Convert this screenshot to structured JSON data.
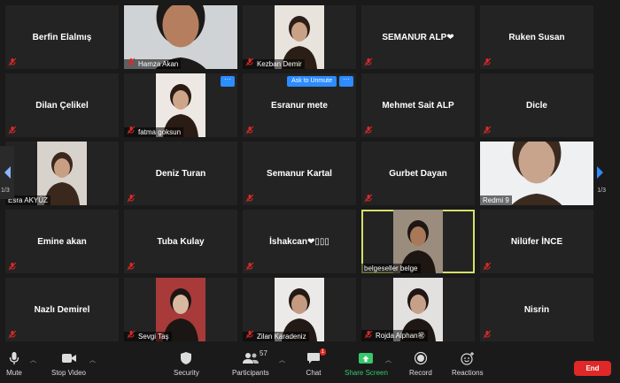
{
  "tiles": [
    {
      "type": "name",
      "name": "Berfin Elalmış"
    },
    {
      "type": "video",
      "label": "Hamza Akan",
      "bg": "#cfd3d6",
      "skin": "#b57f5f",
      "hair": "#1c1a18",
      "wide": "full"
    },
    {
      "type": "video",
      "label": "Kezban Demir",
      "bg": "#e8e3dc",
      "skin": "#c9a186",
      "hair": "#2b1e16",
      "wide": "narrow"
    },
    {
      "type": "name",
      "name": "SEMANUR ALP❤"
    },
    {
      "type": "name",
      "name": "Ruken Susan"
    },
    {
      "type": "name",
      "name": "Dilan Çelikel"
    },
    {
      "type": "video",
      "label": "fatma goksun",
      "bg": "#ede8e3",
      "skin": "#cfa58a",
      "hair": "#2a1b14",
      "wide": "narrow",
      "more": "···"
    },
    {
      "type": "name",
      "name": "Esranur  mete",
      "unmute": "Ask to Unmute",
      "more": "···"
    },
    {
      "type": "name",
      "name": "Mehmet Sait ALP"
    },
    {
      "type": "name",
      "name": "Dicle"
    },
    {
      "type": "video",
      "label": "Esra AKYÜZ",
      "bg": "#d8d2cc",
      "skin": "#c99f84",
      "hair": "#3a281d",
      "wide": "narrow",
      "nomic": true
    },
    {
      "type": "name",
      "name": "Deniz Turan"
    },
    {
      "type": "name",
      "name": "Semanur Kartal"
    },
    {
      "type": "name",
      "name": "Gurbet Dayan"
    },
    {
      "type": "video",
      "label": "Redmi 9",
      "bg": "#eef0f2",
      "skin": "#c9a48c",
      "hair": "#3b2a1f",
      "wide": "full",
      "nomic": true
    },
    {
      "type": "name",
      "name": "Emine akan"
    },
    {
      "type": "name",
      "name": "Tuba Kulay"
    },
    {
      "type": "name",
      "name": "İshakcan❤▯▯▯"
    },
    {
      "type": "video",
      "label": "belgeseller belge",
      "bg": "#9a8d7d",
      "skin": "#a97858",
      "hair": "#1d1612",
      "wide": "narrow",
      "active": true,
      "nomic": true
    },
    {
      "type": "name",
      "name": "Nilüfer İNCE"
    },
    {
      "type": "name",
      "name": "Nazlı Demirel"
    },
    {
      "type": "video",
      "label": "Sevgi Taş",
      "bg": "#a83a3a",
      "skin": "#d9b8a2",
      "hair": "#1b1614",
      "wide": "narrow"
    },
    {
      "type": "video",
      "label": "Zilan Karadeniz",
      "bg": "#eceae8",
      "skin": "#c49a80",
      "hair": "#231a15",
      "wide": "narrow"
    },
    {
      "type": "video",
      "label": "Rojda Alphan㊗",
      "bg": "#e3e1df",
      "skin": "#c7a089",
      "hair": "#1f1713",
      "wide": "narrow"
    },
    {
      "type": "name",
      "name": "Nisrin"
    }
  ],
  "pager": {
    "left": "1/3",
    "right": "1/3"
  },
  "toolbar": {
    "mute": "Mute",
    "stop_video": "Stop Video",
    "security": "Security",
    "participants": "Participants",
    "participants_count": "57",
    "chat": "Chat",
    "chat_badge": "1",
    "share_screen": "Share Screen",
    "record": "Record",
    "reactions": "Reactions",
    "end": "End"
  },
  "colors": {
    "accent": "#2d8cff",
    "end": "#e02828",
    "share": "#38c76a",
    "active_speaker": "#d6e06a",
    "mute_icon": "#e02828"
  }
}
